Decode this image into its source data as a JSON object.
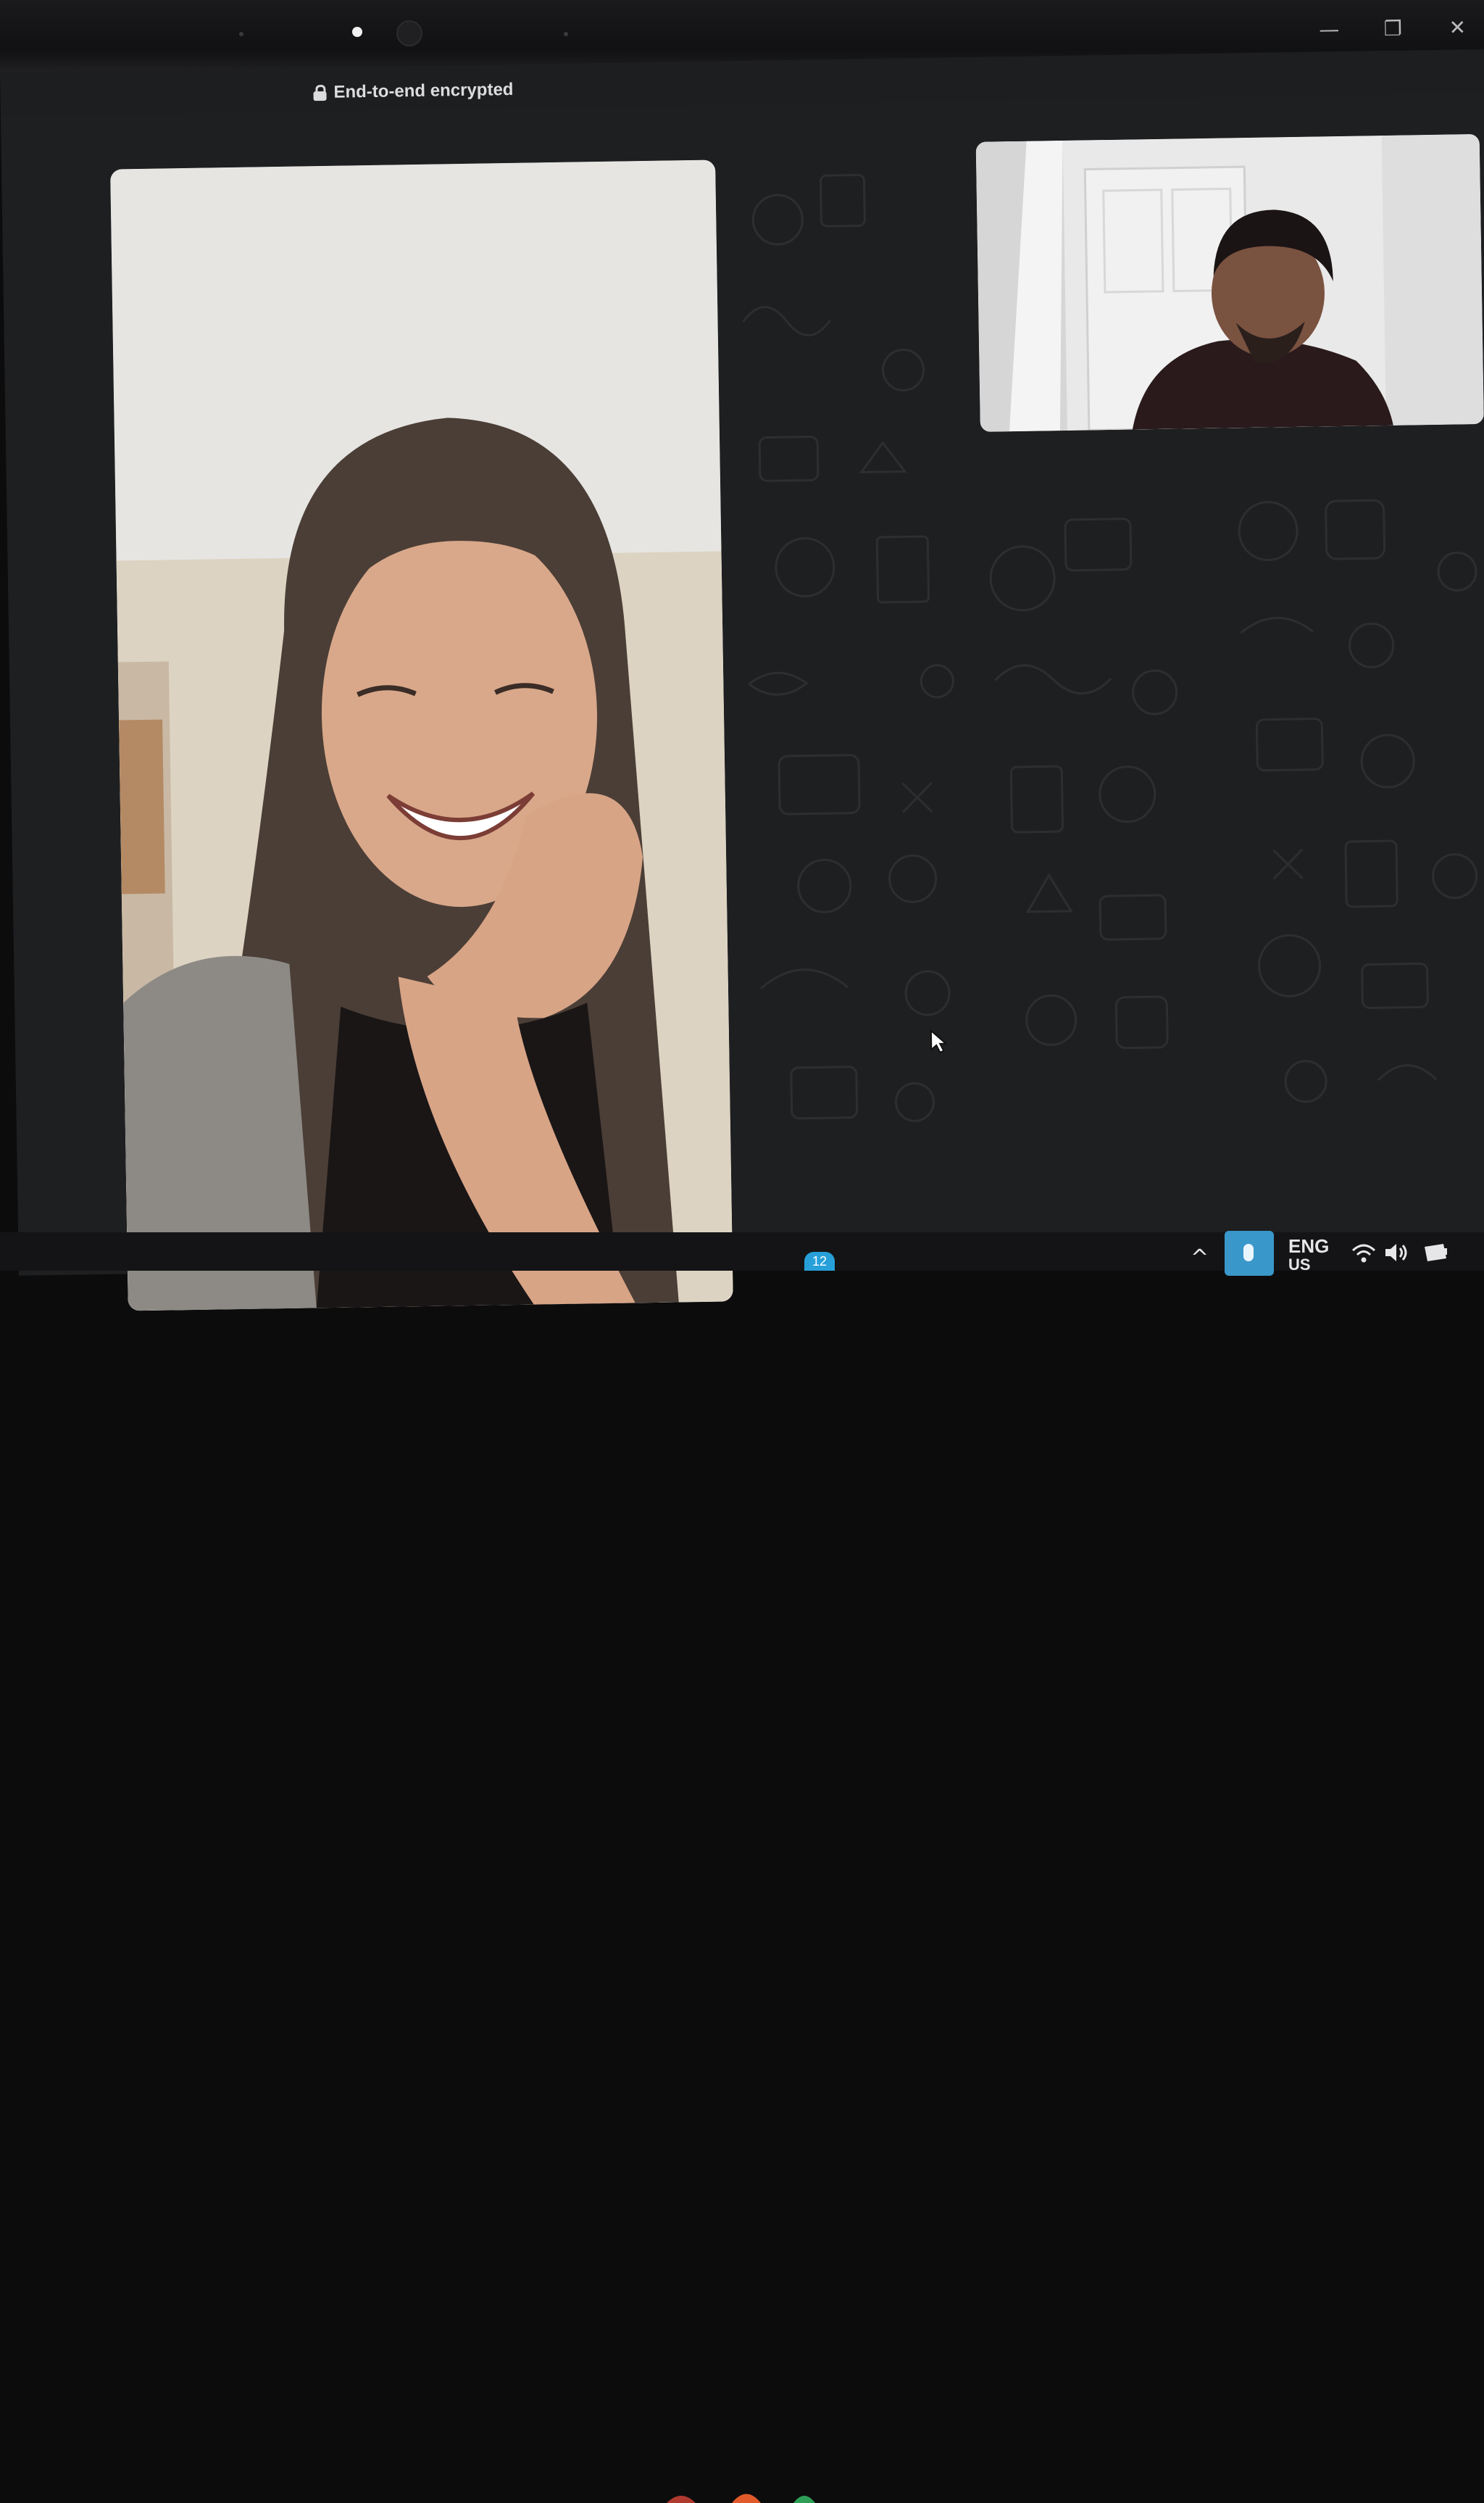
{
  "window": {
    "encryption_notice": "End-to-end encrypted",
    "controls": {
      "minimize": "—",
      "maximize": "❐",
      "close": "✕"
    }
  },
  "call": {
    "main_participant": "remote-video",
    "self_view": "local-video"
  },
  "taskbar": {
    "show_hidden_icons": "^",
    "language": "ENG",
    "language_sub": "US",
    "notification_badge": "12"
  },
  "colors": {
    "background": "#1d1e20",
    "text": "#dcdcdf",
    "accent": "#3a97c9"
  }
}
